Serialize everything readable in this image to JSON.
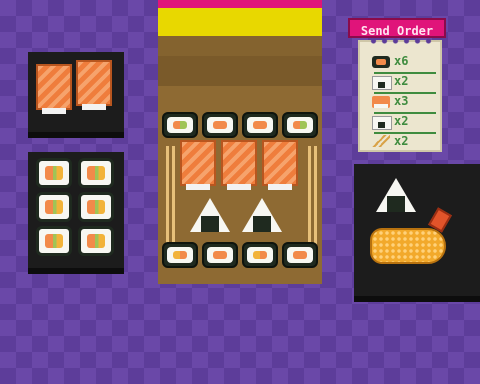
{
  "send_order": {
    "label": "Send Order"
  },
  "order_items": [
    {
      "icon": "maki-icon",
      "count": "x6"
    },
    {
      "icon": "onigiri-icon",
      "count": "x2"
    },
    {
      "icon": "shrimp-nigiri-icon",
      "count": "x3"
    },
    {
      "icon": "onigiri-icon",
      "count": "x2"
    },
    {
      "icon": "chopsticks-icon",
      "count": "x2"
    }
  ],
  "colors": {
    "header_magenta": "#e0147a",
    "header_yellow": "#e8d800",
    "tray_brown": "#7a5a2f",
    "panel_dark": "#1c1c1c"
  }
}
